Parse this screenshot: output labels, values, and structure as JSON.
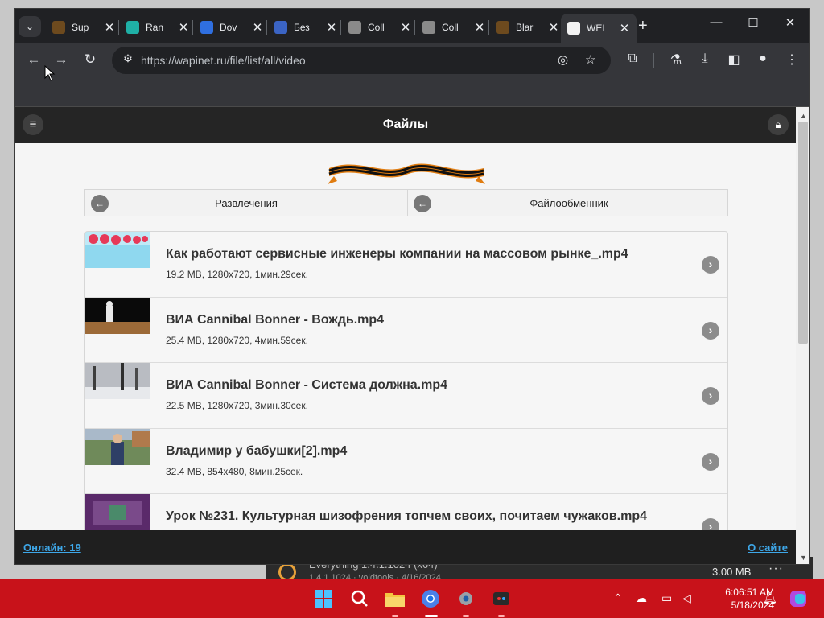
{
  "background_app": {
    "title": "Everything 1.4.1.1024 (x64)",
    "subtitle": "1.4.1.1024 · voidtools · 4/16/2024",
    "size": "3.00 MB"
  },
  "browser": {
    "tabs": [
      {
        "label": "Sup",
        "icon_color": "#6d4a1e"
      },
      {
        "label": "Ran",
        "icon_color": "#1fb0a6"
      },
      {
        "label": "Dov",
        "icon_color": "#2f6fe0"
      },
      {
        "label": "Без",
        "icon_color": "#3b64c4"
      },
      {
        "label": "Coll",
        "icon_color": "#8a8a8a"
      },
      {
        "label": "Coll",
        "icon_color": "#8a8a8a"
      },
      {
        "label": "Blar",
        "icon_color": "#6d4a1e"
      },
      {
        "label": "WEI",
        "icon_color": "#f2f2f2"
      }
    ],
    "new_tab": "+",
    "window_controls": {
      "minimize": "—",
      "maximize": "☐",
      "close": "✕"
    },
    "url": "https://wapinet.ru/file/list/all/video"
  },
  "page": {
    "header_title": "Файлы",
    "nav": {
      "left": "Развлечения",
      "right": "Файлообменник"
    },
    "files": [
      {
        "title": "Как работают сервисные инженеры компании на массовом рынке_.mp4",
        "meta": "19.2 MB, 1280x720, 1мин.29сек.",
        "thumb": "pink-logo"
      },
      {
        "title": "ВИА Cannibal Bonner - Вождь.mp4",
        "meta": "25.4 MB, 1280x720, 4мин.59сек.",
        "thumb": "figure-dark"
      },
      {
        "title": "ВИА Cannibal Bonner - Система должна.mp4",
        "meta": "22.5 MB, 1280x720, 3мин.30сек.",
        "thumb": "snow-trees"
      },
      {
        "title": "Владимир у бабушки[2].mp4",
        "meta": "32.4 MB, 854x480, 8мин.25сек.",
        "thumb": "man-outdoor"
      },
      {
        "title": "Урок №231. Культурная шизофрения топчем своих, почитаем чужаков.mp4",
        "meta": "",
        "thumb": "purple"
      }
    ],
    "footer": {
      "online": "Онлайн: 19",
      "about": "О сайте"
    }
  },
  "taskbar": {
    "time": "6:06:51 AM",
    "date": "5/18/2024",
    "accent": "#c8121a"
  }
}
